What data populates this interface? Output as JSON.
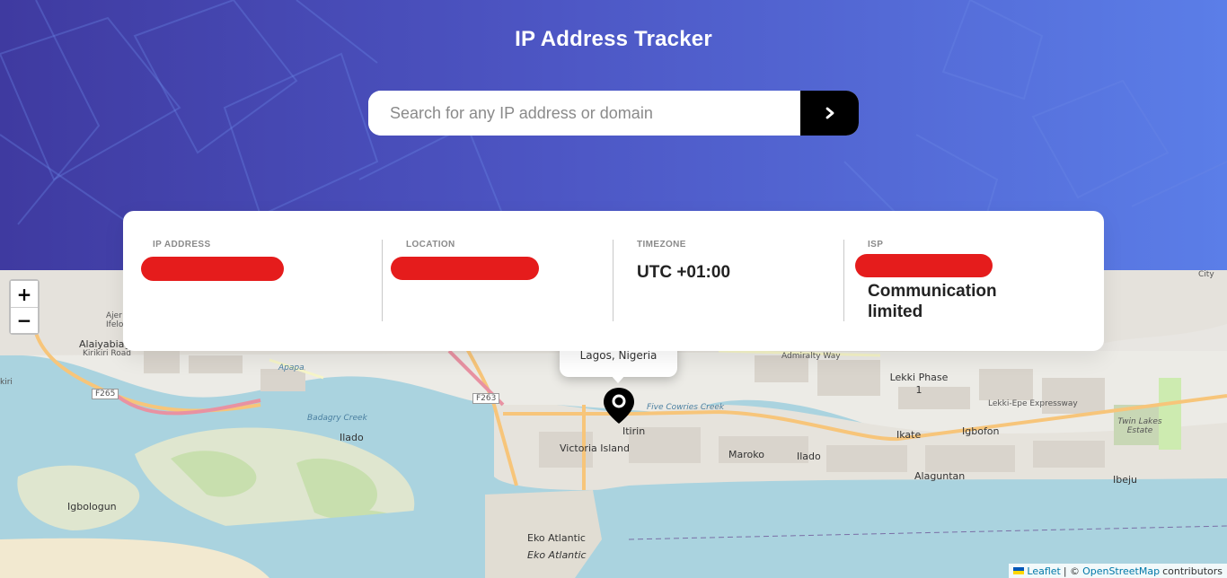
{
  "header": {
    "title": "IP Address Tracker",
    "search": {
      "placeholder": "Search for any IP address or domain",
      "value": ""
    },
    "submit_icon": "chevron-right-icon"
  },
  "info": {
    "ip": {
      "label": "IP ADDRESS",
      "value": ""
    },
    "location": {
      "label": "LOCATION",
      "value": ""
    },
    "timezone": {
      "label": "TIMEZONE",
      "value": "UTC +01:00"
    },
    "isp": {
      "label": "ISP",
      "value": "Communication limited"
    }
  },
  "map": {
    "zoom_in": "+",
    "zoom_out": "−",
    "popup": "Lagos, Nigeria",
    "labels": {
      "alaiyabiagba": "Alaiyabiagba",
      "kirikiri": "Kirikiri Road",
      "apapa": "Apapa",
      "ilado": "Ilado",
      "igbologun": "Igbologun",
      "victoria_island": "Victoria Island",
      "itirin": "Itirin",
      "maroko": "Maroko",
      "ilado2": "Ilado",
      "ikate": "Ikate",
      "igbofon": "Igbofon",
      "lekki": "Lekki Phase 1",
      "alaguntan": "Alaguntan",
      "ibeju": "Ibeju",
      "eko_atlantic": "Eko Atlantic",
      "eko_atlantic2": "Eko Atlantic",
      "twin_lakes": "Twin Lakes Estate",
      "f265": "F265",
      "f263": "F263",
      "admiralty": "Admiralty Way",
      "lekki_epe": "Lekki-Epe Expressway",
      "five_cowries": "Five Cowries Creek",
      "badagry": "Badagry Creek",
      "city": "City",
      "kiri": "kiri",
      "ajer": "Ajer",
      "ifelo": "Ifelo"
    }
  },
  "attribution": {
    "leaflet": "Leaflet",
    "osm": "OpenStreetMap",
    "suffix": "contributors",
    "sep": "| ©"
  },
  "colors": {
    "header_start": "#3f3aa0",
    "header_end": "#5b7ee8",
    "redaction": "#e51c1c",
    "water": "#aad3df"
  }
}
